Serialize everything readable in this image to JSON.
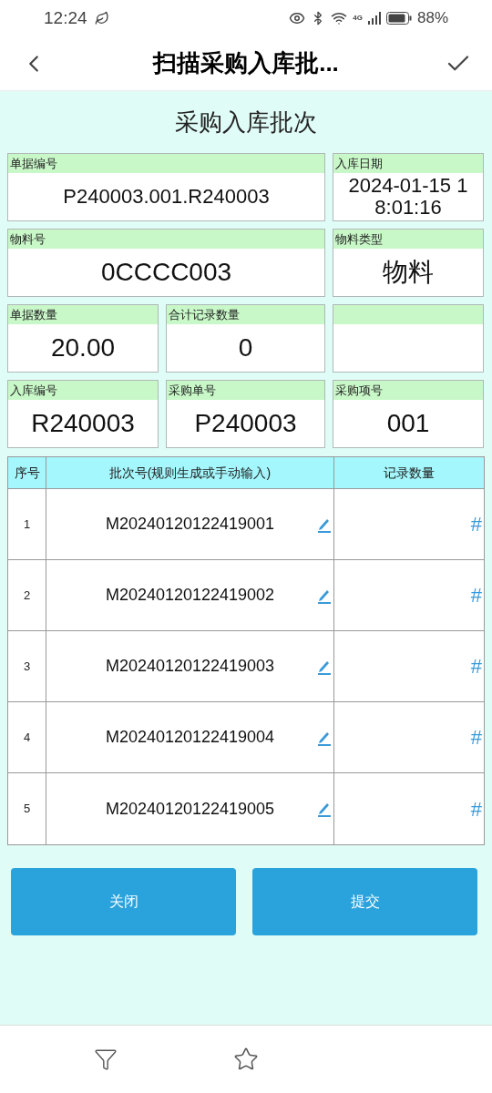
{
  "status_bar": {
    "time": "12:24",
    "network": "4G",
    "battery": "88%"
  },
  "header": {
    "title": "扫描采购入库批..."
  },
  "form": {
    "title": "采购入库批次",
    "fields": [
      {
        "kind": "wide",
        "label": "单据编号",
        "value": "P240003.001.R240003"
      },
      {
        "kind": "normal",
        "label": "入库日期",
        "value": "2024-01-15 18:01:16"
      },
      {
        "kind": "wide",
        "label": "物料号",
        "value": "0CCCC003"
      },
      {
        "kind": "normal",
        "label": "物料类型",
        "value": "物料"
      },
      {
        "kind": "normal",
        "label": "单据数量",
        "value": "20.00"
      },
      {
        "kind": "normal",
        "label": "合计记录数量",
        "value": "0"
      },
      {
        "kind": "blank"
      },
      {
        "kind": "normal",
        "label": "入库编号",
        "value": "R240003"
      },
      {
        "kind": "normal",
        "label": "采购单号",
        "value": "P240003"
      },
      {
        "kind": "normal",
        "label": "采购项号",
        "value": "001"
      }
    ]
  },
  "table": {
    "columns": [
      "序号",
      "批次号(规则生成或手动输入)",
      "记录数量"
    ],
    "rows": [
      {
        "index": "1",
        "batch": "M20240120122419001",
        "count_icon": "#"
      },
      {
        "index": "2",
        "batch": "M20240120122419002",
        "count_icon": "#"
      },
      {
        "index": "3",
        "batch": "M20240120122419003",
        "count_icon": "#"
      },
      {
        "index": "4",
        "batch": "M20240120122419004",
        "count_icon": "#"
      },
      {
        "index": "5",
        "batch": "M20240120122419005",
        "count_icon": "#"
      }
    ]
  },
  "buttons": [
    "关闭",
    "提交"
  ]
}
